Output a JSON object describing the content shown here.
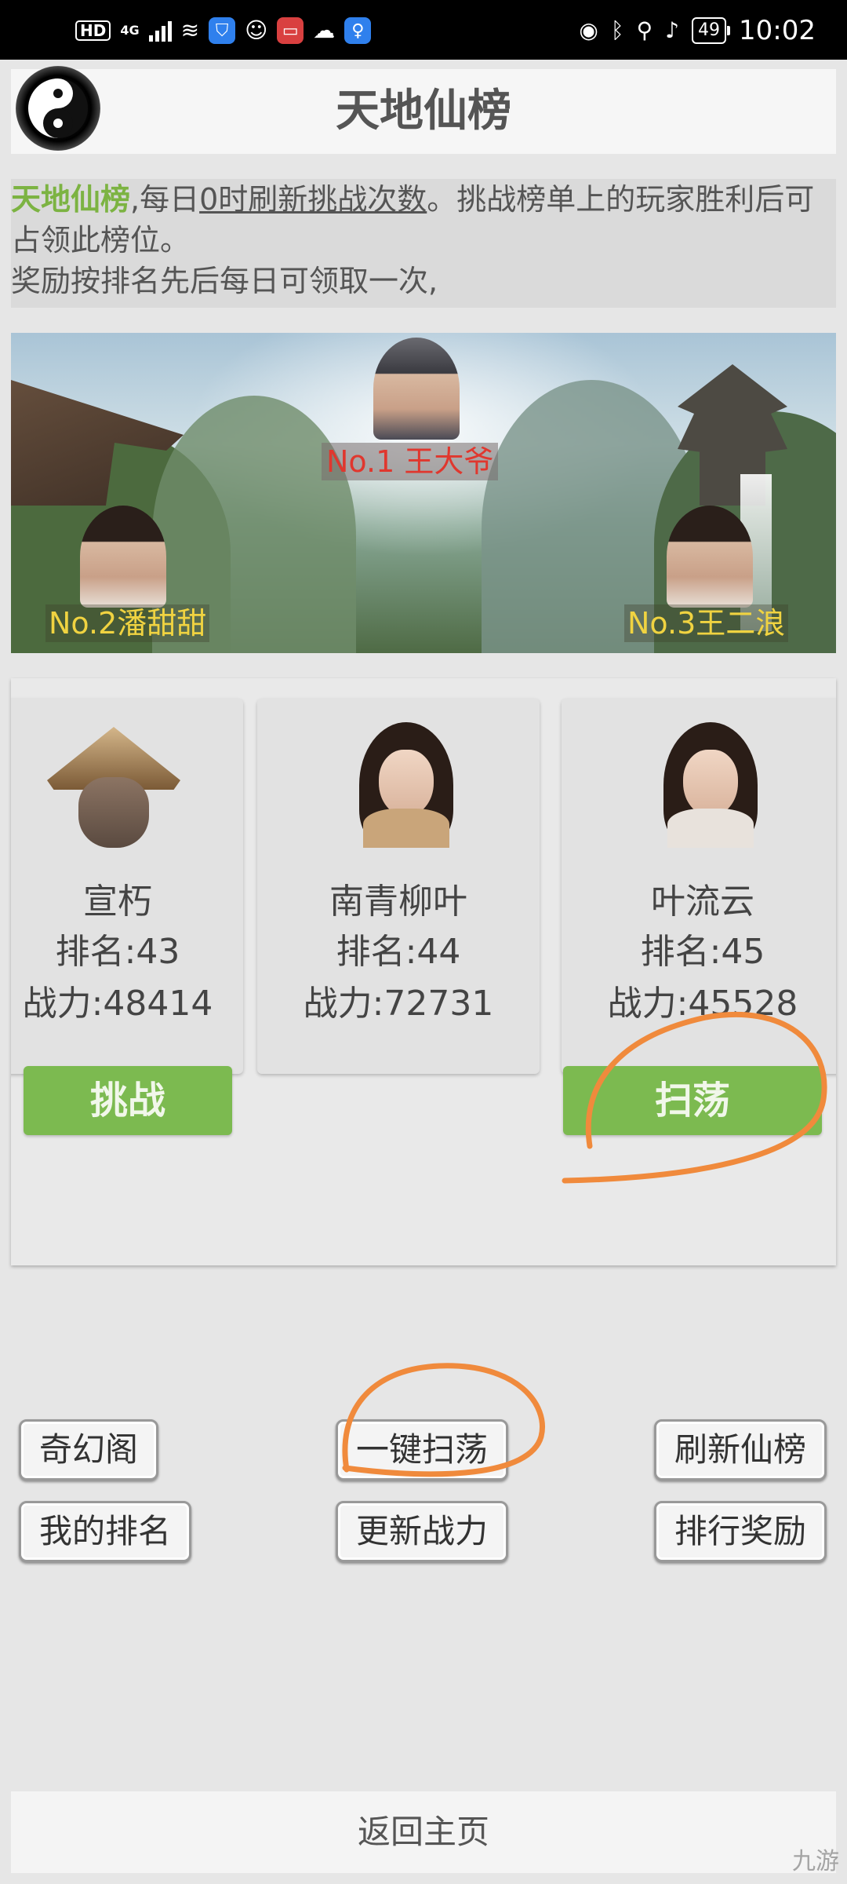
{
  "status_bar": {
    "hd": "HD",
    "network": "4G",
    "battery": "49",
    "time": "10:02"
  },
  "header": {
    "title": "天地仙榜"
  },
  "info": {
    "highlight": "天地仙榜",
    "part1": ",每日",
    "underlined": "0时刷新挑战次数",
    "part2": "。挑战榜单上的玩家胜利后可占领此榜位。",
    "line3": "奖励按排名先后每日可领取一次,"
  },
  "banner": {
    "top1": "No.1 王大爷",
    "top2": "No.2潘甜甜",
    "top3": "No.3王二浪"
  },
  "challengers": [
    {
      "name": "宣朽",
      "rank": "排名:43",
      "power": "战力:48414",
      "button": "挑战"
    },
    {
      "name": "南青柳叶",
      "rank": "排名:44",
      "power": "战力:72731"
    },
    {
      "name": "叶流云",
      "rank": "排名:45",
      "power": "战力:45528",
      "button": "扫荡"
    }
  ],
  "buttons": {
    "qihuange": "奇幻阁",
    "sweep_all": "一键扫荡",
    "refresh": "刷新仙榜",
    "my_rank": "我的排名",
    "update_power": "更新战力",
    "rank_reward": "排行奖励"
  },
  "footer": {
    "back": "返回主页"
  },
  "watermark": "九游",
  "colors": {
    "accent_green": "#7cba50",
    "rank1_red": "#e0372e",
    "rank_gold": "#f0d341",
    "annotation_orange": "#f08a3c"
  }
}
